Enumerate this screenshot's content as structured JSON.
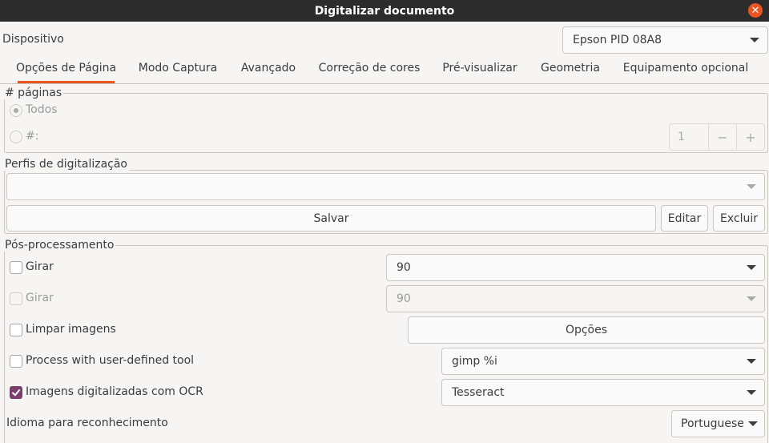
{
  "window": {
    "title": "Digitalizar documento",
    "close_symbol": "✕"
  },
  "device": {
    "label": "Dispositivo",
    "selected": "Epson PID 08A8"
  },
  "tabs": [
    {
      "label": "Opções de Página",
      "active": true
    },
    {
      "label": "Modo Captura"
    },
    {
      "label": "Avançado"
    },
    {
      "label": "Correção de cores"
    },
    {
      "label": "Pré-visualizar"
    },
    {
      "label": "Geometria"
    },
    {
      "label": "Equipamento opcional"
    }
  ],
  "pages": {
    "legend": "# páginas",
    "all_label": "Todos",
    "count_label": "#:",
    "count_value": "1",
    "minus": "−",
    "plus": "+"
  },
  "profiles": {
    "legend": "Perfis de digitalização",
    "selected": "",
    "save_label": "Salvar",
    "edit_label": "Editar",
    "delete_label": "Excluir"
  },
  "postprocessing": {
    "legend": "Pós-processamento",
    "rotate": {
      "label": "Girar",
      "value": "90",
      "checked": false
    },
    "rotate2": {
      "label": "Girar",
      "value": "90",
      "checked": false,
      "disabled": true
    },
    "clean": {
      "label": "Limpar imagens",
      "button": "Opções",
      "checked": false
    },
    "user_tool": {
      "label": "Process with user-defined tool",
      "value": "gimp %i",
      "checked": false
    },
    "ocr": {
      "label": "Imagens digitalizadas com OCR",
      "value": "Tesseract",
      "checked": true
    },
    "language": {
      "label": "Idioma para reconhecimento",
      "value": "Portuguese"
    }
  },
  "colors": {
    "accent": "#e95420",
    "check": "#7b3f6d",
    "titlebar": "#2c2c2c"
  }
}
